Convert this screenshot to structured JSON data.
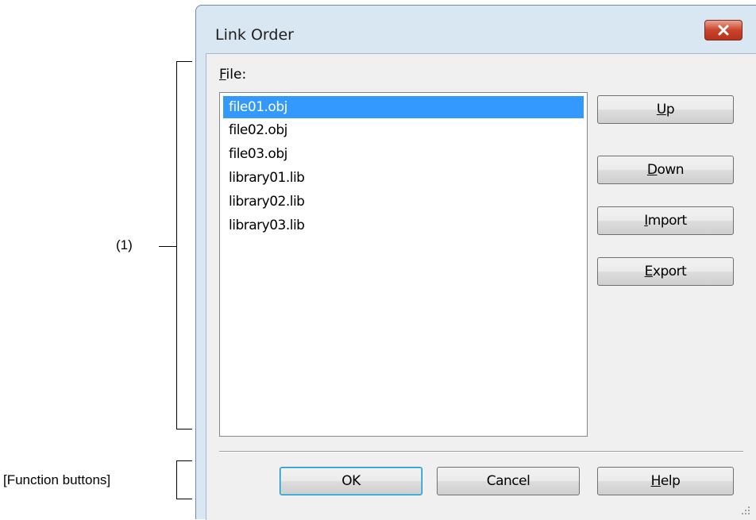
{
  "annotations": {
    "item1_label": "(1)",
    "function_buttons_label": "[Function buttons]"
  },
  "dialog": {
    "title": "Link Order",
    "file_label_mnemonic": "F",
    "file_label_rest": "ile:",
    "files": [
      {
        "name": "file01.obj",
        "selected": true
      },
      {
        "name": "file02.obj",
        "selected": false
      },
      {
        "name": "file03.obj",
        "selected": false
      },
      {
        "name": "library01.lib",
        "selected": false
      },
      {
        "name": "library02.lib",
        "selected": false
      },
      {
        "name": "library03.lib",
        "selected": false
      }
    ],
    "buttons": {
      "up": {
        "mnemonic": "U",
        "rest": "p"
      },
      "down": {
        "mnemonic": "D",
        "rest": "own"
      },
      "import": {
        "mnemonic": "I",
        "rest": "mport"
      },
      "export": {
        "mnemonic": "E",
        "rest": "xport"
      }
    },
    "function_buttons": {
      "ok": "OK",
      "cancel": "Cancel",
      "help_mnemonic": "H",
      "help_rest": "elp"
    }
  },
  "colors": {
    "selection": "#3399ff",
    "close_button": "#c9442b",
    "window_frame": "#d9e7f3"
  },
  "icons": {
    "close": "close-icon",
    "resize_grip": "resize-grip-icon"
  }
}
